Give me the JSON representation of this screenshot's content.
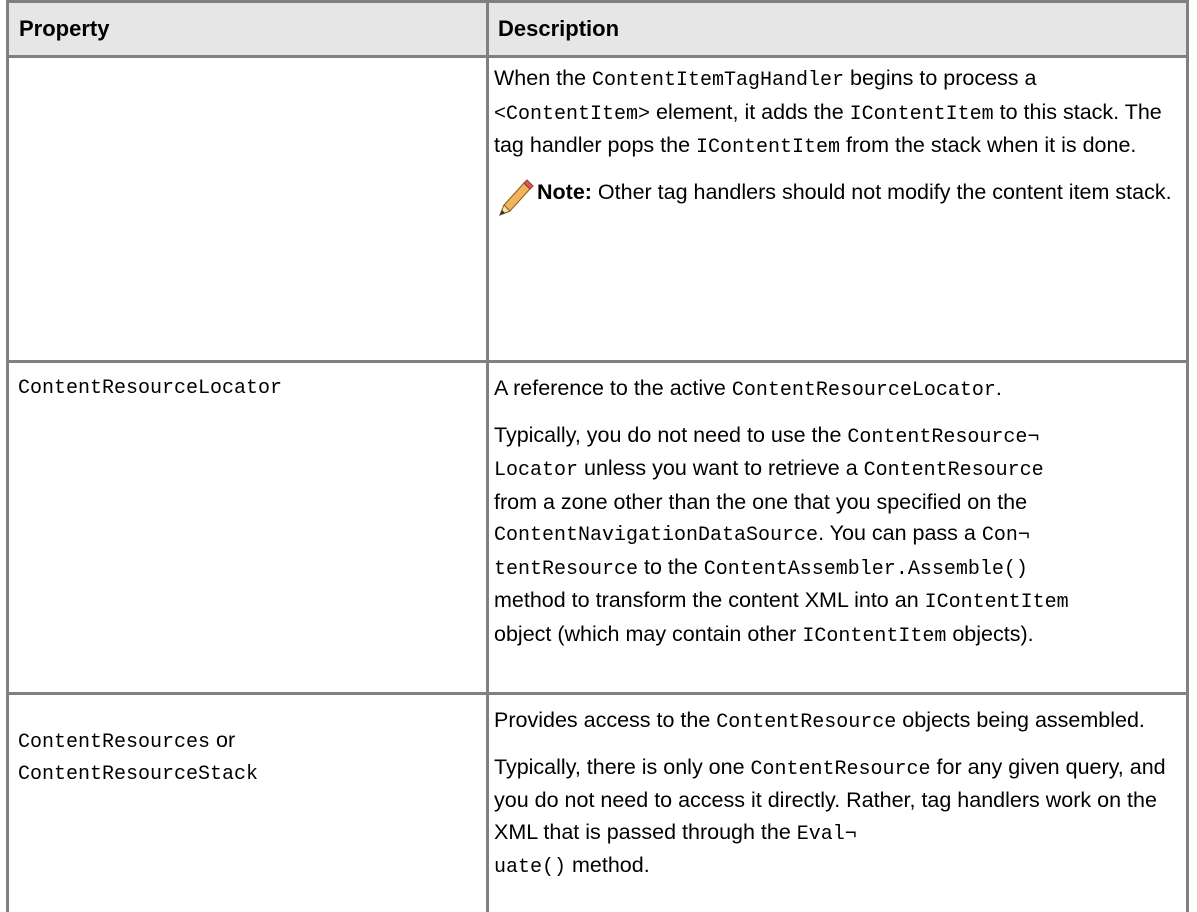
{
  "header": {
    "property": "Property",
    "description": "Description"
  },
  "row1": {
    "d1_a": "When the ",
    "d1_code1": "ContentItemTagHandler",
    "d1_b": " begins to process a",
    "d1_code2": "<ContentItem>",
    "d1_c": " element, it adds the ",
    "d1_code3": "IContentItem",
    "d1_d": " to this stack. The tag handler pops the ",
    "d1_code4": "IContentItem",
    "d1_e": " from the stack when it is done.",
    "note_label": "Note:",
    "note_text": " Other tag handlers should not modify the content item stack."
  },
  "row2": {
    "property": "ContentResourceLocator",
    "p1_a": "A reference to the active ",
    "p1_code": "ContentResourceLocator",
    "p1_b": ".",
    "p2_a": "Typically, you do not need to use the ",
    "p2_code1a": "ContentResource¬",
    "p2_code1b": "Locator",
    "p2_b": " unless you want to retrieve a ",
    "p2_code2": "ContentResource",
    "p2_c": "from a zone other than the one that you specified on the",
    "p2_code3": "ContentNavigationDataSource",
    "p2_d": ". You can pass a ",
    "p2_code4a": "Con¬",
    "p2_code4b": "tentResource",
    "p2_e": " to the ",
    "p2_code5": "ContentAssembler.Assemble()",
    "p2_f": "method to transform the content XML into an ",
    "p2_code6": "IContentItem",
    "p2_g": "object (which may contain other ",
    "p2_code7": "IContentItem",
    "p2_h": " objects)."
  },
  "row3": {
    "property_a": "ContentResources",
    "property_or": " or",
    "property_b": "ContentResourceStack",
    "p1_a": "Provides access to the ",
    "p1_code": "ContentResource",
    "p1_b": " objects being assembled.",
    "p2_a": "Typically, there is only one ",
    "p2_code1": "ContentResource",
    "p2_b": " for any given query, and you do not need to access it directly. Rather, tag handlers work on the XML that is passed through the ",
    "p2_code2a": "Eval¬",
    "p2_code2b": "uate()",
    "p2_c": " method."
  },
  "colors": {
    "border": "#808080",
    "header_bg": "#e6e6e6",
    "pencil": "#e8a24a"
  }
}
